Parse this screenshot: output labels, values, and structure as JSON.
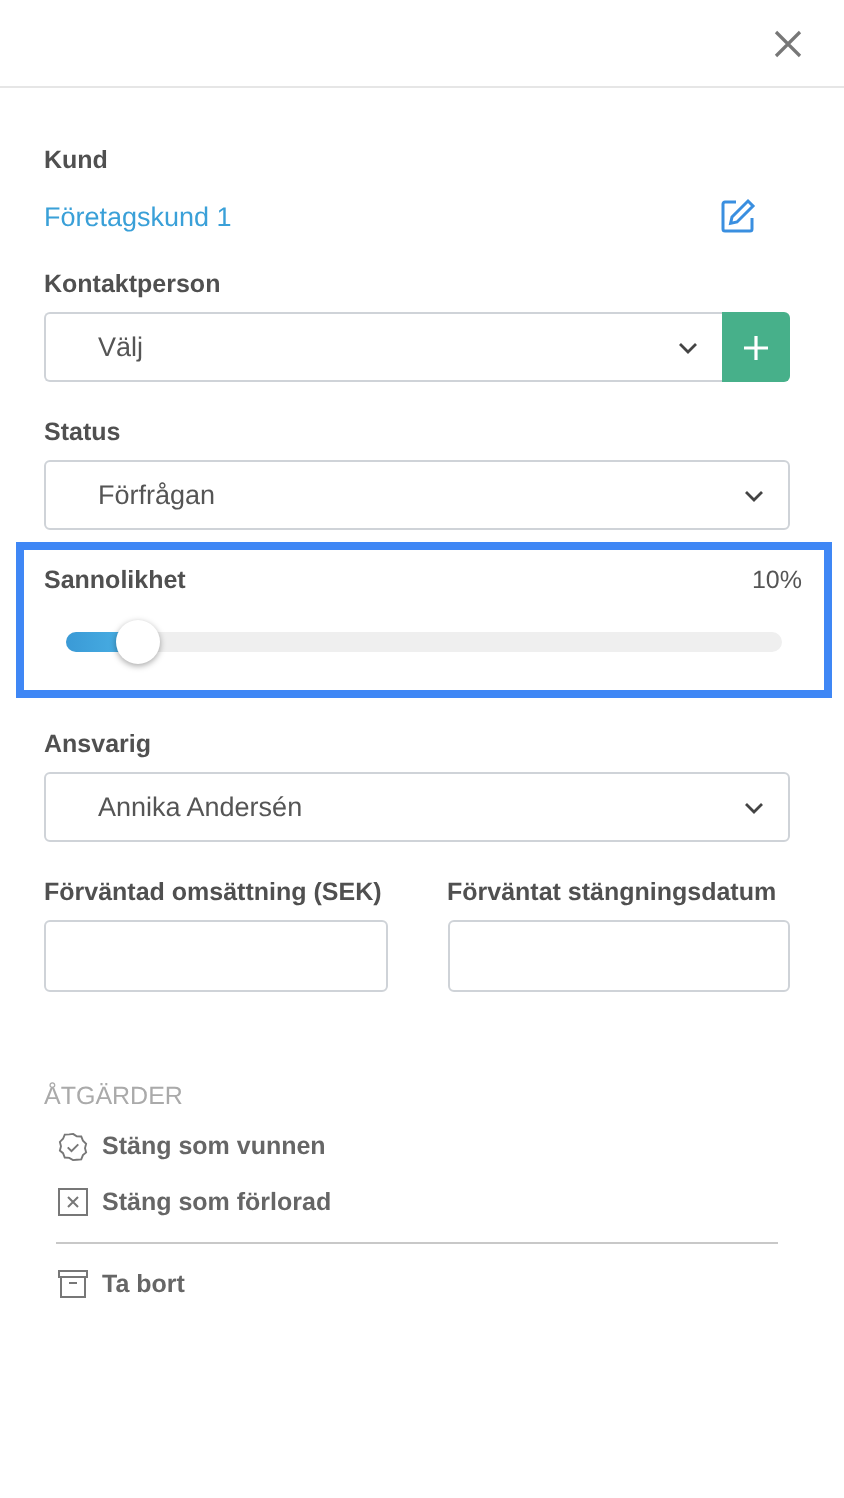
{
  "fields": [
    {
      "kind": "link",
      "label": "Kund",
      "value": "Företagskund 1"
    },
    {
      "kind": "select",
      "label": "Kontaktperson",
      "value": "Välj",
      "add_button": true
    },
    {
      "kind": "select",
      "label": "Status",
      "value": "Förfrågan",
      "add_button": false
    },
    {
      "kind": "slider",
      "label": "Sannolikhet",
      "reading": "10%",
      "level": 0.1,
      "highlighted": true
    },
    {
      "kind": "select",
      "label": "Ansvarig",
      "value": "Annika Andersén",
      "add_button": false
    },
    {
      "kind": "pair",
      "items": [
        {
          "label": "Förväntad omsättning (SEK)"
        },
        {
          "label": "Förväntat stängningsdatum"
        }
      ]
    }
  ],
  "actions": {
    "heading": "ÅTGÄRDER",
    "items": [
      {
        "kind": "won",
        "label": "Stäng som vunnen",
        "separated": false
      },
      {
        "kind": "lost",
        "label": "Stäng som förlorad",
        "separated": false
      },
      {
        "kind": "delete",
        "label": "Ta bort",
        "separated": true
      }
    ]
  }
}
